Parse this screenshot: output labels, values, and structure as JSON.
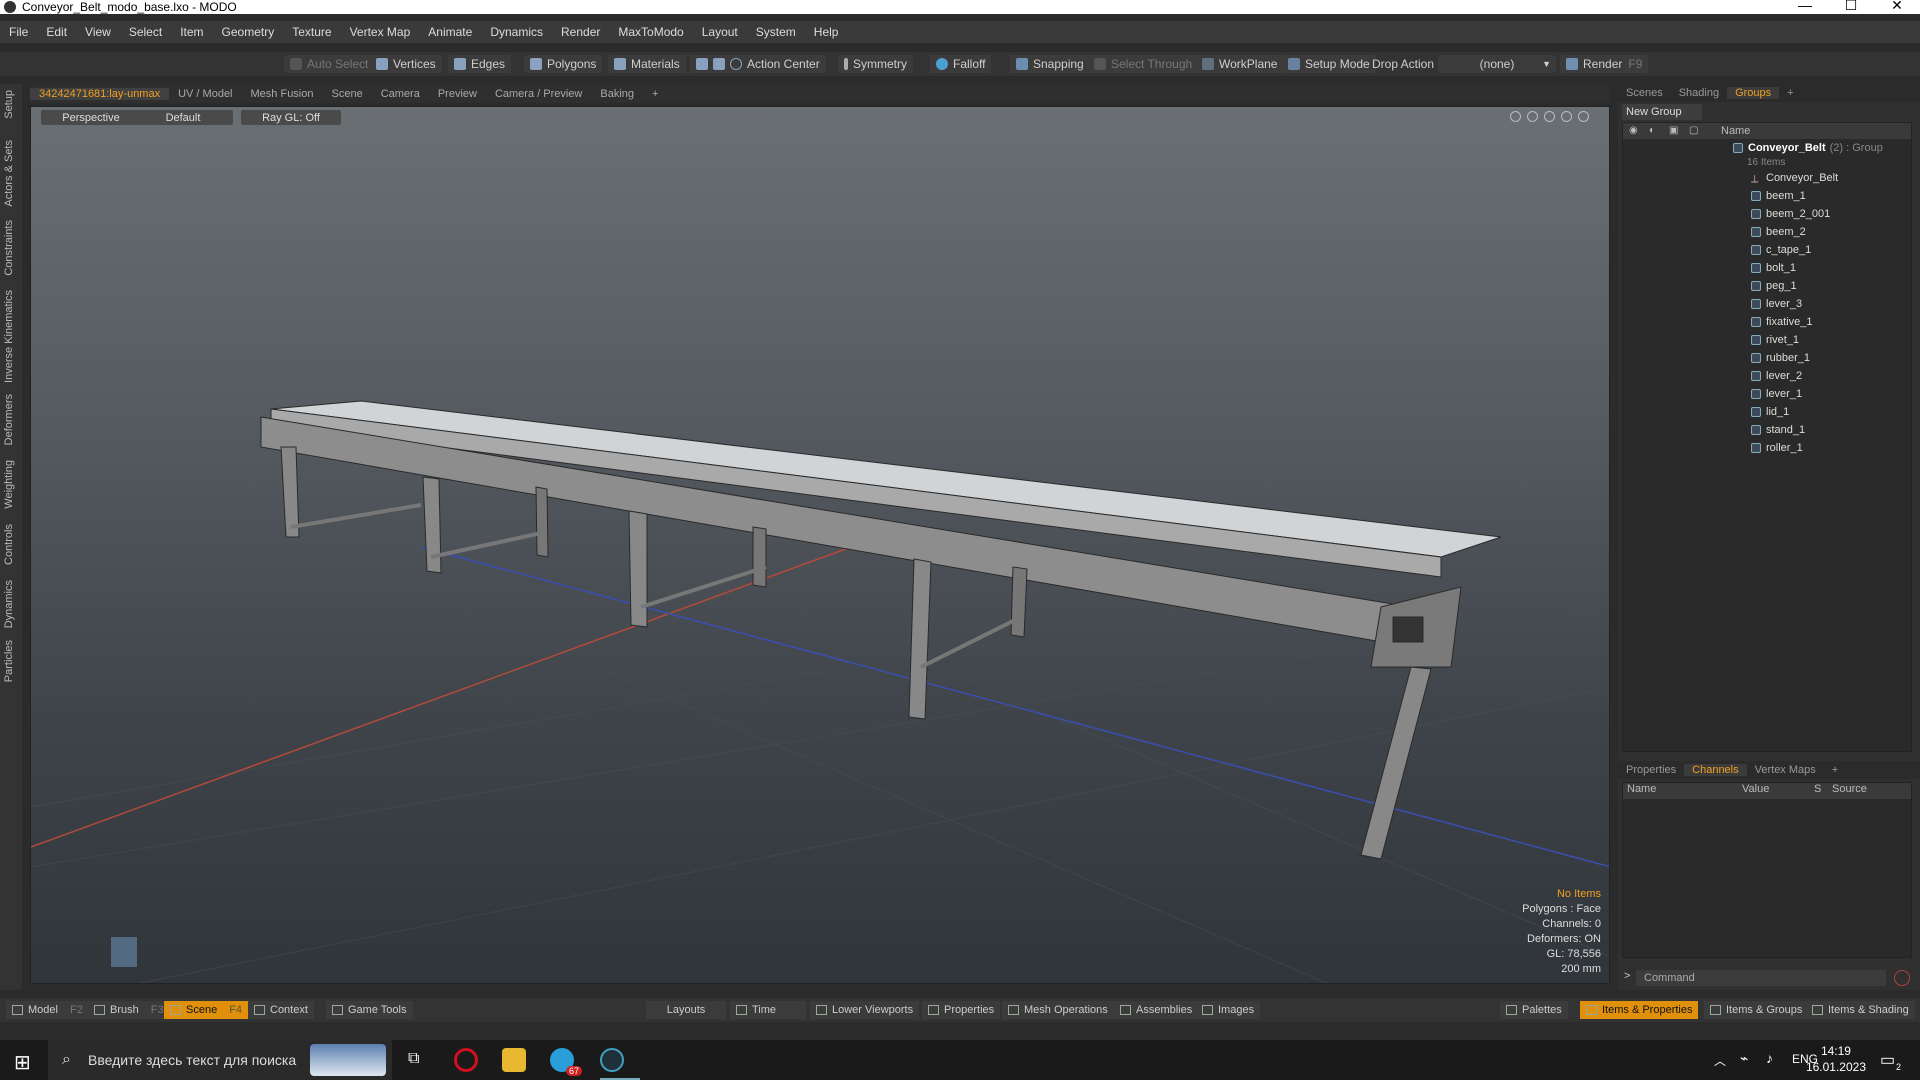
{
  "window": {
    "title": "Conveyor_Belt_modo_base.lxo - MODO"
  },
  "menu": [
    "File",
    "Edit",
    "View",
    "Select",
    "Item",
    "Geometry",
    "Texture",
    "Vertex Map",
    "Animate",
    "Dynamics",
    "Render",
    "MaxToModo",
    "Layout",
    "System",
    "Help"
  ],
  "toolbar": {
    "auto_select": "Auto Select",
    "vertices": "Vertices",
    "edges": "Edges",
    "polygons": "Polygons",
    "materials": "Materials",
    "action_center": "Action Center",
    "symmetry": "Symmetry",
    "falloff": "Falloff",
    "snapping": "Snapping",
    "select_through": "Select Through",
    "workplane": "WorkPlane",
    "setup_mode": "Setup Mode",
    "drop_action": "Drop Action",
    "drop_value": "(none)",
    "render": "Render",
    "render_key": "F9"
  },
  "left_tabs": [
    "Setup",
    "Actors & Sets",
    "Constraints",
    "Inverse Kinematics",
    "Deformers",
    "Weighting",
    "Controls",
    "Dynamics",
    "Particles"
  ],
  "viewport_tabs": [
    "34242471681:lay-unmax",
    "UV / Model",
    "Mesh Fusion",
    "Scene",
    "Camera",
    "Preview",
    "Camera / Preview",
    "Baking",
    "+"
  ],
  "viewport": {
    "view": "Perspective",
    "shading": "Default",
    "raygl": "Ray GL: Off",
    "info": {
      "items": "No Items",
      "polygons": "Polygons : Face",
      "channels": "Channels: 0",
      "deformers": "Deformers: ON",
      "gl": "GL: 78,556",
      "scale": "200 mm"
    }
  },
  "right_top_tabs": [
    "Scenes",
    "Shading",
    "Groups",
    "+"
  ],
  "groups": {
    "new_group": "New Group",
    "col_name": "Name",
    "group_name": "Conveyor_Belt",
    "group_meta": "(2) : Group",
    "group_count": "16 Items",
    "items": [
      "Conveyor_Belt",
      "beem_1",
      "beem_2_001",
      "beem_2",
      "c_tape_1",
      "bolt_1",
      "peg_1",
      "lever_3",
      "fixative_1",
      "rivet_1",
      "rubber_1",
      "lever_2",
      "lever_1",
      "lid_1",
      "stand_1",
      "roller_1"
    ]
  },
  "right_bottom_tabs": [
    "Properties",
    "Channels",
    "Vertex Maps",
    "+"
  ],
  "channels": {
    "cols": [
      "Name",
      "Value",
      "S",
      "Source"
    ]
  },
  "command": {
    "placeholder": "Command"
  },
  "bottom": {
    "model": "Model",
    "model_key": "F2",
    "brush": "Brush",
    "brush_key": "F3",
    "scene": "Scene",
    "scene_key": "F4",
    "context": "Context",
    "game_tools": "Game Tools",
    "layouts": "Layouts",
    "time": "Time",
    "lower_viewports": "Lower Viewports",
    "properties": "Properties",
    "mesh_operations": "Mesh Operations",
    "assemblies": "Assemblies",
    "images": "Images",
    "palettes": "Palettes",
    "items_properties": "Items & Properties",
    "items_groups": "Items & Groups",
    "items_shading": "Items & Shading"
  },
  "taskbar": {
    "search": "Введите здесь текст для поиска",
    "lang": "ENG",
    "time": "14:19",
    "date": "16.01.2023",
    "telegram_badge": "67",
    "notif_count": "2"
  }
}
